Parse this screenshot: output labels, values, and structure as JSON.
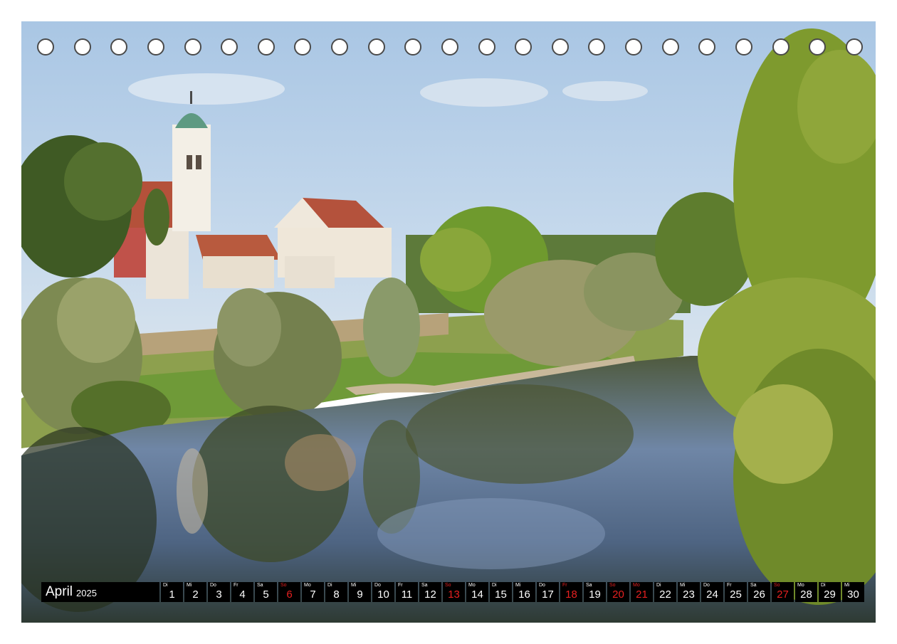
{
  "calendar": {
    "month": "April",
    "year": "2025",
    "ring_hole_count": 23,
    "days": [
      {
        "wd": "Di",
        "num": "1",
        "weekend": false
      },
      {
        "wd": "Mi",
        "num": "2",
        "weekend": false
      },
      {
        "wd": "Do",
        "num": "3",
        "weekend": false
      },
      {
        "wd": "Fr",
        "num": "4",
        "weekend": false
      },
      {
        "wd": "Sa",
        "num": "5",
        "weekend": false
      },
      {
        "wd": "So",
        "num": "6",
        "weekend": true
      },
      {
        "wd": "Mo",
        "num": "7",
        "weekend": false
      },
      {
        "wd": "Di",
        "num": "8",
        "weekend": false
      },
      {
        "wd": "Mi",
        "num": "9",
        "weekend": false
      },
      {
        "wd": "Do",
        "num": "10",
        "weekend": false
      },
      {
        "wd": "Fr",
        "num": "11",
        "weekend": false
      },
      {
        "wd": "Sa",
        "num": "12",
        "weekend": false
      },
      {
        "wd": "So",
        "num": "13",
        "weekend": true
      },
      {
        "wd": "Mo",
        "num": "14",
        "weekend": false
      },
      {
        "wd": "Di",
        "num": "15",
        "weekend": false
      },
      {
        "wd": "Mi",
        "num": "16",
        "weekend": false
      },
      {
        "wd": "Do",
        "num": "17",
        "weekend": false
      },
      {
        "wd": "Fr",
        "num": "18",
        "weekend": true
      },
      {
        "wd": "Sa",
        "num": "19",
        "weekend": false
      },
      {
        "wd": "So",
        "num": "20",
        "weekend": true
      },
      {
        "wd": "Mo",
        "num": "21",
        "weekend": true
      },
      {
        "wd": "Di",
        "num": "22",
        "weekend": false
      },
      {
        "wd": "Mi",
        "num": "23",
        "weekend": false
      },
      {
        "wd": "Do",
        "num": "24",
        "weekend": false
      },
      {
        "wd": "Fr",
        "num": "25",
        "weekend": false
      },
      {
        "wd": "Sa",
        "num": "26",
        "weekend": false
      },
      {
        "wd": "So",
        "num": "27",
        "weekend": true
      },
      {
        "wd": "Mo",
        "num": "28",
        "weekend": false
      },
      {
        "wd": "Di",
        "num": "29",
        "weekend": false
      },
      {
        "wd": "Mi",
        "num": "30",
        "weekend": false
      }
    ]
  },
  "colors": {
    "strip_background": "#000000",
    "weekday_text": "#ffffff",
    "holiday_text": "#e62020"
  }
}
